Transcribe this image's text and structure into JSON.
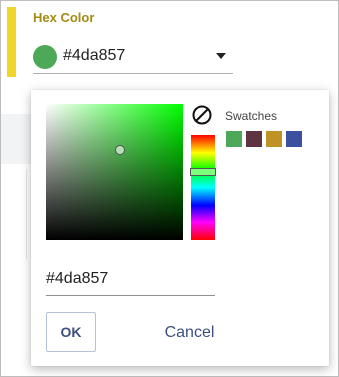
{
  "field": {
    "label": "Hex Color",
    "value": "#4da857",
    "swatch_color": "#4da857",
    "accent_color": "#f2d52b",
    "dropdown_icon": "caret-down-icon"
  },
  "picker": {
    "saturation": 0.54,
    "brightness": 0.66,
    "hue_degrees": 126,
    "no_color_icon": "no-color-icon",
    "swatches_label": "Swatches",
    "swatches": [
      "#4da857",
      "#5e3440",
      "#bf9224",
      "#3b51a0"
    ],
    "hex_input_value": "#4da857",
    "ok_label": "OK",
    "cancel_label": "Cancel",
    "button_text_color": "#3d4f7c"
  }
}
